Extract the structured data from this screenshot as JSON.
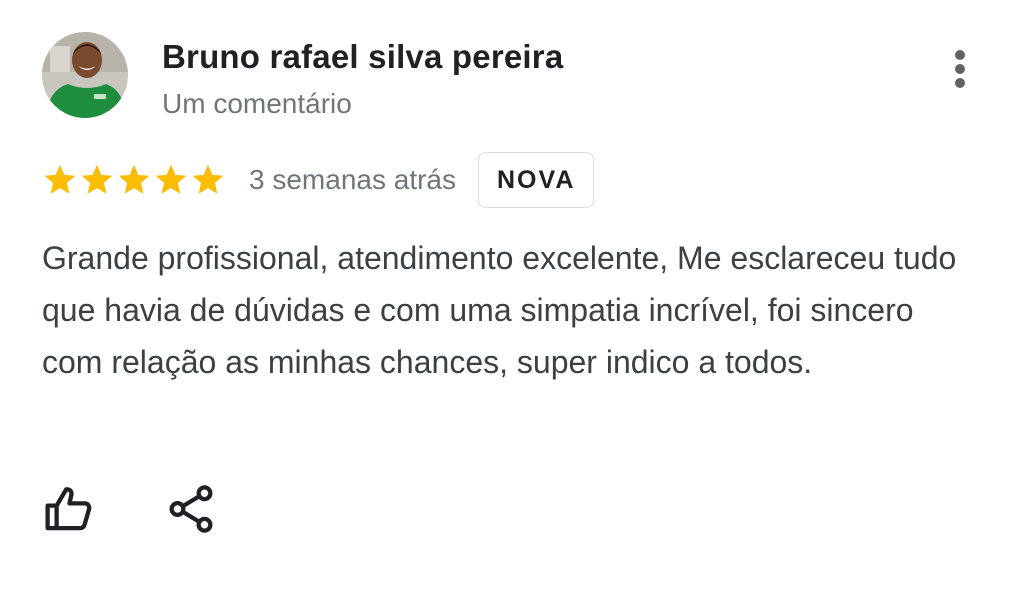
{
  "review": {
    "author_name": "Bruno rafael silva pereira",
    "author_meta": "Um comentário",
    "rating": 5,
    "rating_max": 5,
    "date": "3 semanas atrás",
    "badge": "NOVA",
    "text": "Grande profissional, atendimento excelente, Me esclareceu tudo que havia de dúvidas e com uma simpatia incrível, foi sincero com relação as minhas chances, super indico a todos."
  },
  "icons": {
    "avatar": "avatar",
    "more": "more-vert-icon",
    "star": "star-icon",
    "like": "thumb-up-icon",
    "share": "share-icon"
  },
  "colors": {
    "star": "#fbbc04",
    "name": "#202124",
    "meta": "#70757a",
    "body": "#3c4043",
    "icon": "#202124",
    "badge_border": "#dadce0",
    "avatar_shirt": "#1e8e3e"
  }
}
